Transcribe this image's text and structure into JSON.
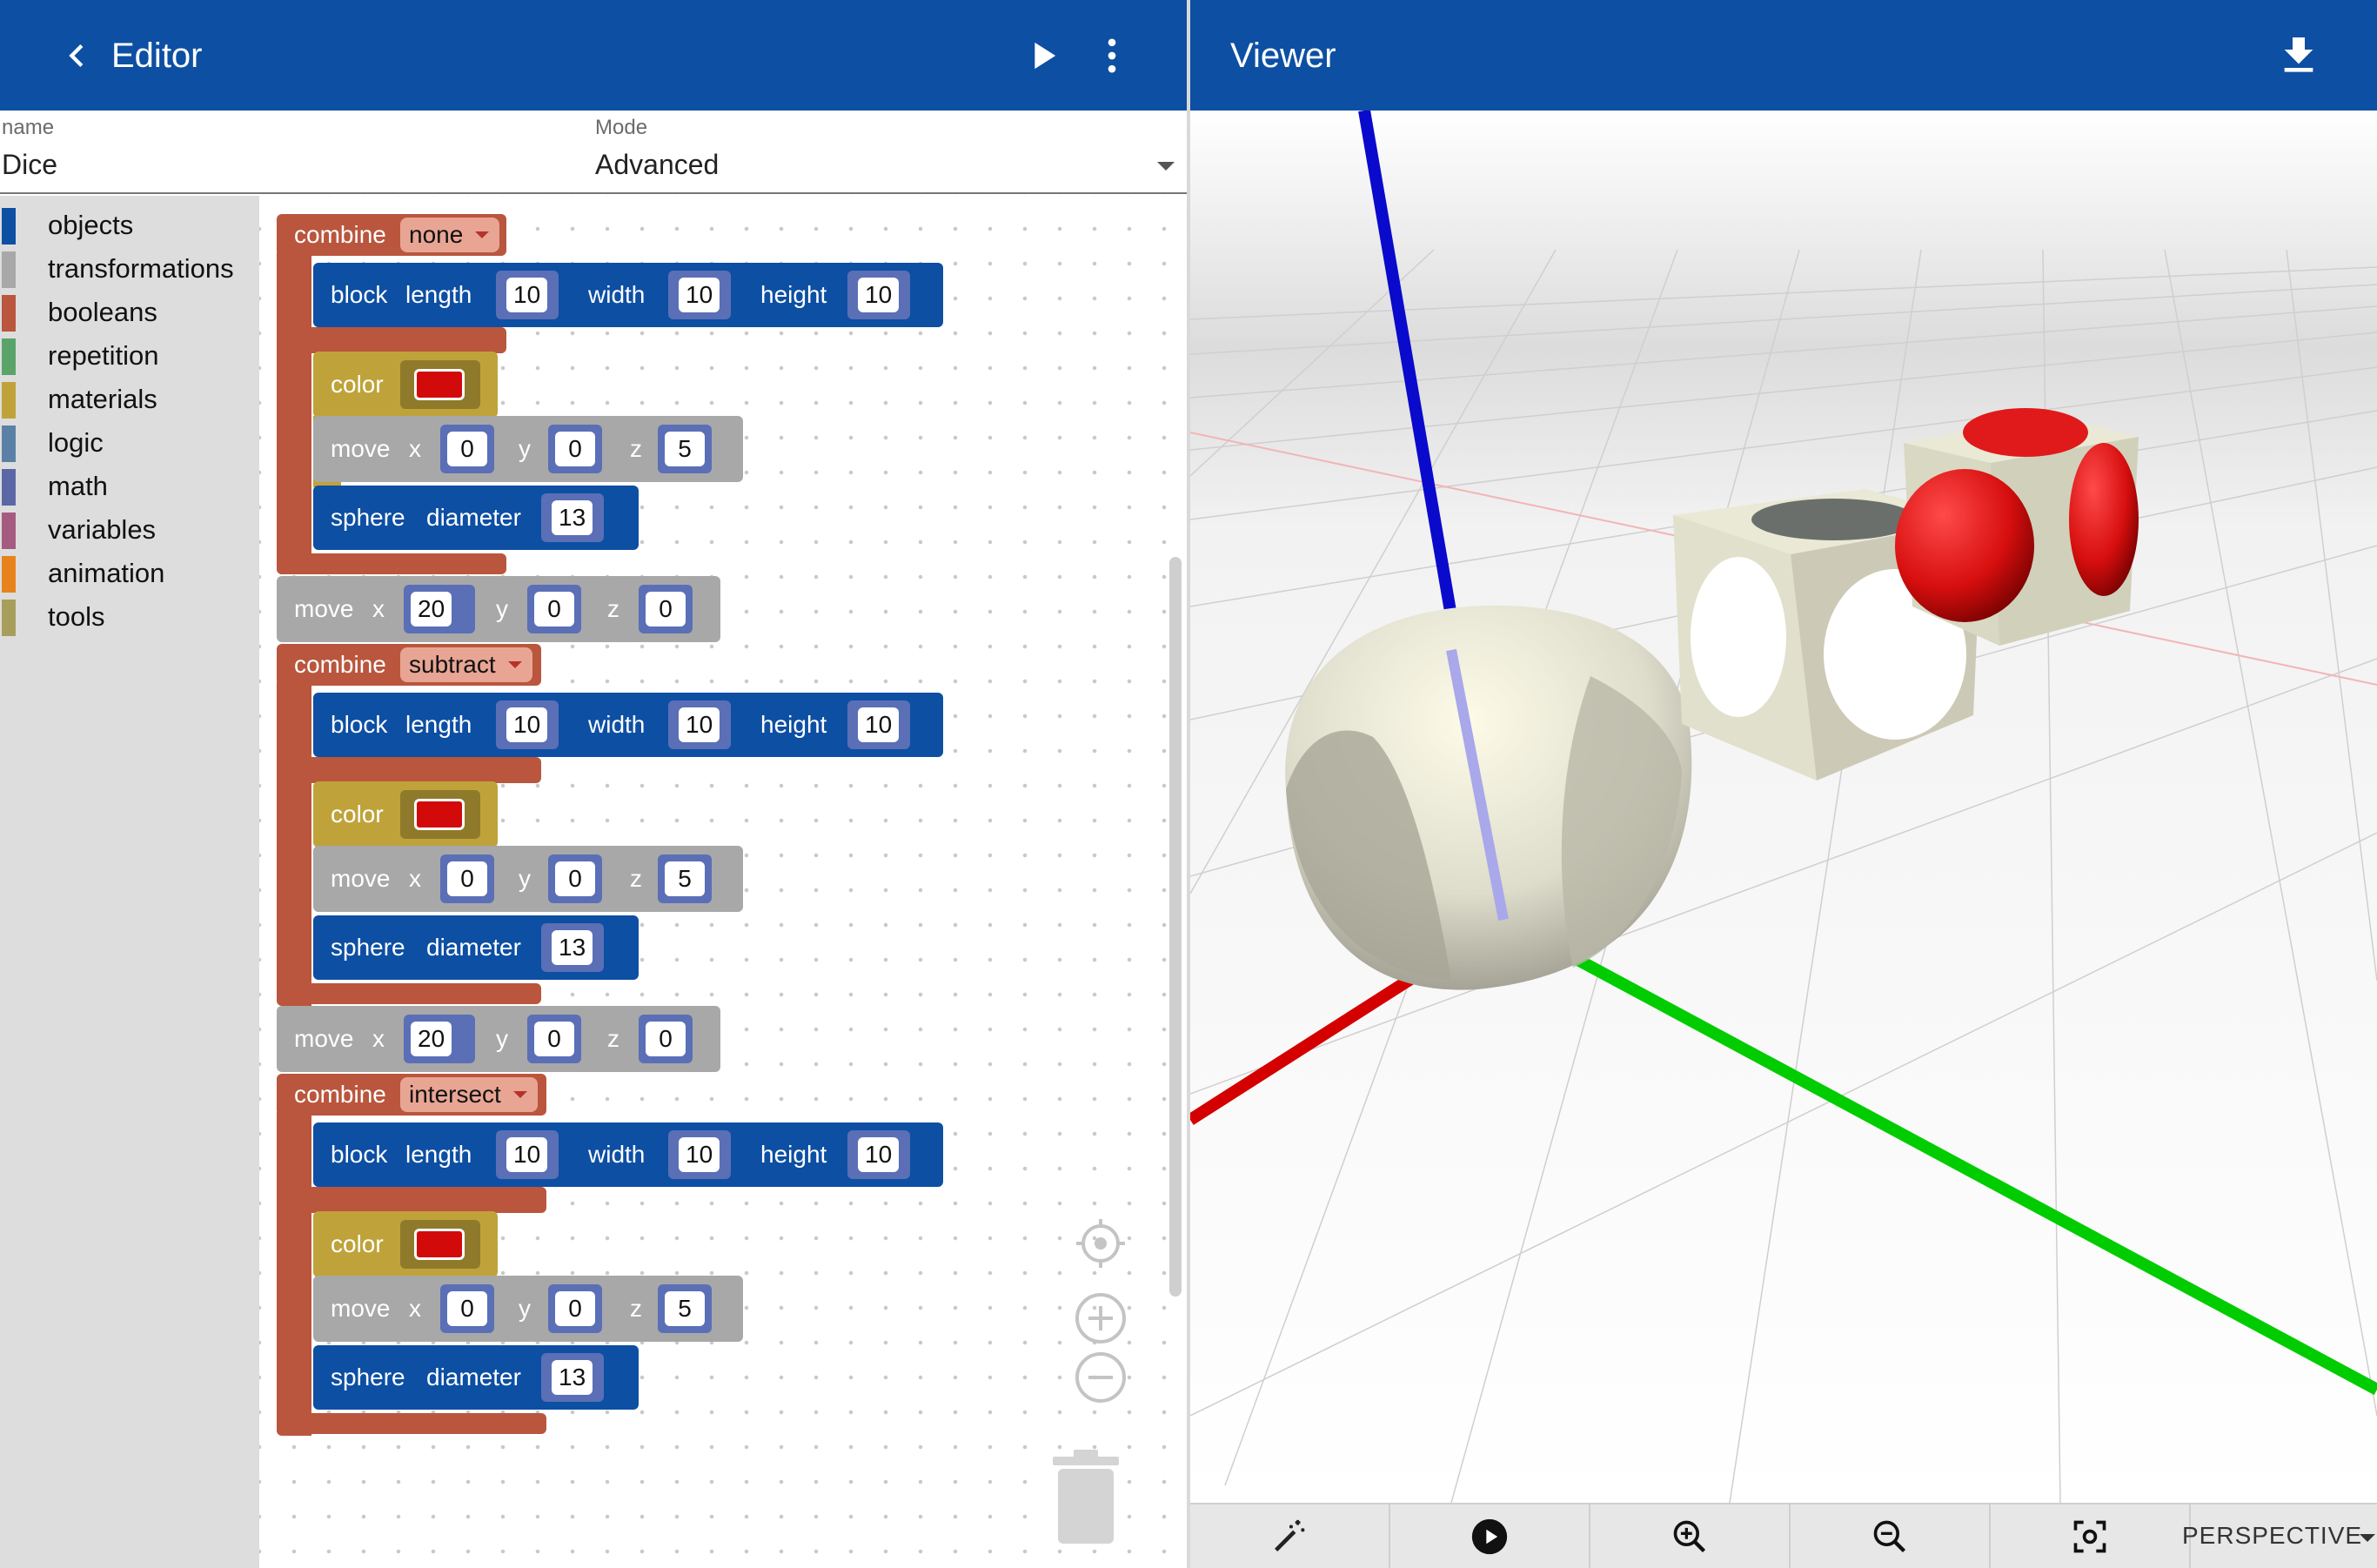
{
  "editor": {
    "title": "Editor"
  },
  "viewer": {
    "title": "Viewer",
    "projection": "PERSPECTIVE"
  },
  "fields": {
    "name_label": "name",
    "name_value": "Dice",
    "mode_label": "Mode",
    "mode_value": "Advanced"
  },
  "toolbox": [
    {
      "label": "objects",
      "color": "#0d4fa3"
    },
    {
      "label": "transformations",
      "color": "#a8a8a8"
    },
    {
      "label": "booleans",
      "color": "#b9563d"
    },
    {
      "label": "repetition",
      "color": "#5aa469"
    },
    {
      "label": "materials",
      "color": "#bfa33a"
    },
    {
      "label": "logic",
      "color": "#5b80a5"
    },
    {
      "label": "math",
      "color": "#5b67a5"
    },
    {
      "label": "variables",
      "color": "#a55b80"
    },
    {
      "label": "animation",
      "color": "#e8821c"
    },
    {
      "label": "tools",
      "color": "#a89e5c"
    }
  ],
  "blocks": {
    "combine": "combine",
    "block": "block",
    "length": "length",
    "width": "width",
    "height": "height",
    "color": "color",
    "move": "move",
    "x": "x",
    "y": "y",
    "z": "z",
    "sphere": "sphere",
    "diameter": "diameter",
    "groups": [
      {
        "op": "none",
        "block": [
          "10",
          "10",
          "10"
        ],
        "move": [
          "0",
          "0",
          "5"
        ],
        "diameter": "13",
        "after_move": [
          "20",
          "0",
          "0"
        ]
      },
      {
        "op": "subtract",
        "block": [
          "10",
          "10",
          "10"
        ],
        "move": [
          "0",
          "0",
          "5"
        ],
        "diameter": "13",
        "after_move": [
          "20",
          "0",
          "0"
        ]
      },
      {
        "op": "intersect",
        "block": [
          "10",
          "10",
          "10"
        ],
        "move": [
          "0",
          "0",
          "5"
        ],
        "diameter": "13"
      }
    ]
  },
  "colors": {
    "header": "#0d4fa3",
    "objects_block": "#0d4fa3",
    "transform_block": "#a8a8a8",
    "boolean_block": "#b9563d",
    "material_block": "#bfa33a",
    "material_color": "#d30a0a"
  },
  "icons": [
    "back-icon",
    "play-icon",
    "more-vert-icon",
    "download-icon",
    "center-icon",
    "zoom-in-icon",
    "zoom-out-icon",
    "trash-icon",
    "magic-wand-icon",
    "play-circle-icon",
    "zoom-in-icon",
    "zoom-out-icon",
    "focus-icon"
  ]
}
